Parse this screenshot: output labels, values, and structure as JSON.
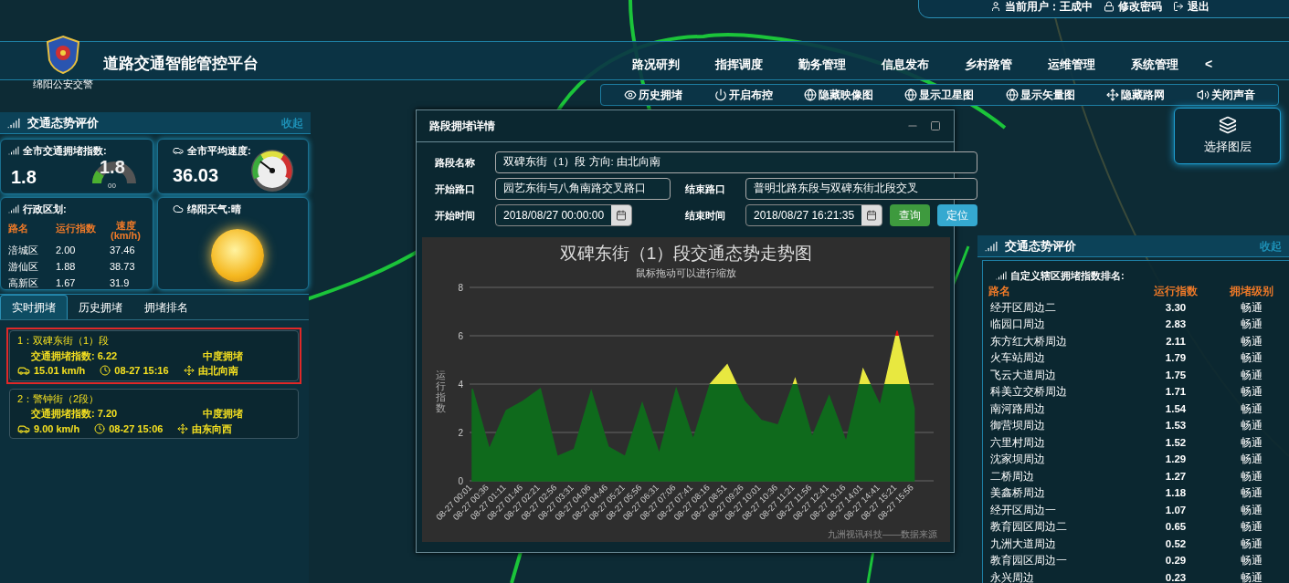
{
  "user_bar": {
    "user": "当前用户：王成中",
    "change_password": "修改密码",
    "logout": "退出"
  },
  "header": {
    "logo_caption": "绵阳公安交警",
    "title": "道路交通智能管控平台",
    "nav": [
      "路况研判",
      "指挥调度",
      "勤务管理",
      "信息发布",
      "乡村路管",
      "运维管理",
      "系统管理"
    ],
    "nav_back": "<"
  },
  "toolbar": [
    {
      "label": "历史拥堵",
      "kind": "eye"
    },
    {
      "label": "开启布控",
      "kind": "power"
    },
    {
      "label": "隐藏映像图",
      "kind": "globe"
    },
    {
      "label": "显示卫星图",
      "kind": "globe"
    },
    {
      "label": "显示矢量图",
      "kind": "globe"
    },
    {
      "label": "隐藏路网",
      "kind": "move"
    },
    {
      "label": "关闭声音",
      "kind": "sound"
    }
  ],
  "layer_button": "选择图层",
  "left_panel": {
    "title": "交通态势评价",
    "collapse": "收起",
    "congestion_index": {
      "label": "全市交通拥堵指数:",
      "value": "1.8",
      "gauge_value": "1.8",
      "gauge_min": "00",
      "level": 0.2
    },
    "avg_speed": {
      "label": "全市平均速度:",
      "value": "36.03"
    },
    "districts": {
      "title": "行政区划:",
      "columns": [
        "路名",
        "运行指数",
        "速度",
        "(km/h)"
      ],
      "rows": [
        {
          "name": "涪城区",
          "index": "2.00",
          "speed": "37.46"
        },
        {
          "name": "游仙区",
          "index": "1.88",
          "speed": "38.73"
        },
        {
          "name": "高新区",
          "index": "1.67",
          "speed": "31.9"
        }
      ]
    },
    "weather": {
      "label": "绵阳天气:晴"
    },
    "tabs": [
      {
        "label": "实时拥堵",
        "selected": true
      },
      {
        "label": "历史拥堵",
        "selected": false
      },
      {
        "label": "拥堵排名",
        "selected": false
      }
    ],
    "jams": [
      {
        "title": "1：双碑东街（1）段",
        "index": "交通拥堵指数: 6.22",
        "grade": "中度拥堵",
        "speed": "15.01 km/h",
        "time": "08-27 15:16",
        "direction": "由北向南",
        "selected": true
      },
      {
        "title": "2：警钟街（2段）",
        "index": "交通拥堵指数: 7.20",
        "grade": "中度拥堵",
        "speed": "9.00 km/h",
        "time": "08-27 15:06",
        "direction": "由东向西",
        "selected": false
      }
    ]
  },
  "dialog": {
    "title": "路段拥堵详情",
    "fields": [
      {
        "label": "路段名称",
        "value": "双碑东街（1）段 方向: 由北向南",
        "kind": "wide"
      },
      {
        "label": "开始路口",
        "value": "园艺东街与八角南路交叉路口",
        "kind": "text"
      },
      {
        "label": "结束路口",
        "value": "普明北路东段与双碑东街北段交叉",
        "kind": "text"
      },
      {
        "label": "开始时间",
        "value": "2018/08/27 00:00:00",
        "kind": "date"
      },
      {
        "label": "结束时间",
        "value": "2018/08/27 16:21:35",
        "kind": "date"
      }
    ],
    "buttons": [
      {
        "label": "查询",
        "kind": "primary"
      },
      {
        "label": "定位",
        "kind": "info"
      }
    ],
    "chart_hint": "鼠标拖动可以进行缩放",
    "chart_credit": "九洲视讯科技——数据来源",
    "chart_data": {
      "type": "area",
      "title": "双碑东街（1）段交通态势走势图",
      "ylabel": "运行指数",
      "categories": [
        "08-27 00:01",
        "08-27 00:36",
        "08-27 01:11",
        "08-27 01:46",
        "08-27 02:21",
        "08-27 02:56",
        "08-27 03:31",
        "08-27 04:06",
        "08-27 04:46",
        "08-27 05:21",
        "08-27 05:56",
        "08-27 06:31",
        "08-27 07:06",
        "08-27 07:41",
        "08-27 08:16",
        "08-27 08:51",
        "08-27 09:26",
        "08-27 10:01",
        "08-27 10:36",
        "08-27 11:21",
        "08-27 11:56",
        "08-27 12:41",
        "08-27 13:16",
        "08-27 14:01",
        "08-27 14:41",
        "08-27 15:21",
        "08-27 15:56"
      ],
      "series": [
        {
          "color": "#0f6a1c",
          "values": [
            3.8,
            1.3,
            2.9,
            3.3,
            3.8,
            1.0,
            1.3,
            3.7,
            1.4,
            1.0,
            3.2,
            1.1,
            3.8,
            1.7,
            4.0,
            4.8,
            3.3,
            2.5,
            2.3,
            4.2,
            1.8,
            3.5,
            1.6,
            4.6,
            3.1,
            6.2,
            3.0
          ]
        }
      ],
      "ylim": [
        0,
        8
      ],
      "yticks": [
        0,
        2,
        4,
        6,
        8
      ],
      "grid": true
    }
  },
  "right_panel": {
    "title": "交通态势评价",
    "collapse": "收起",
    "subtitle": "自定义辖区拥堵指数排名:",
    "columns": [
      "路名",
      "运行指数",
      "拥堵级别"
    ],
    "rows": [
      {
        "name": "经开区周边二",
        "index": "3.30",
        "grade": "畅通"
      },
      {
        "name": "临园口周边",
        "index": "2.83",
        "grade": "畅通"
      },
      {
        "name": "东方红大桥周边",
        "index": "2.11",
        "grade": "畅通"
      },
      {
        "name": "火车站周边",
        "index": "1.79",
        "grade": "畅通"
      },
      {
        "name": "飞云大道周边",
        "index": "1.75",
        "grade": "畅通"
      },
      {
        "name": "科美立交桥周边",
        "index": "1.71",
        "grade": "畅通"
      },
      {
        "name": "南河路周边",
        "index": "1.54",
        "grade": "畅通"
      },
      {
        "name": "御营坝周边",
        "index": "1.53",
        "grade": "畅通"
      },
      {
        "name": "六里村周边",
        "index": "1.52",
        "grade": "畅通"
      },
      {
        "name": "沈家坝周边",
        "index": "1.29",
        "grade": "畅通"
      },
      {
        "name": "二桥周边",
        "index": "1.27",
        "grade": "畅通"
      },
      {
        "name": "美鑫桥周边",
        "index": "1.18",
        "grade": "畅通"
      },
      {
        "name": "经开区周边一",
        "index": "1.07",
        "grade": "畅通"
      },
      {
        "name": "教育园区周边二",
        "index": "0.65",
        "grade": "畅通"
      },
      {
        "name": "九洲大道周边",
        "index": "0.52",
        "grade": "畅通"
      },
      {
        "name": "教育园区周边一",
        "index": "0.29",
        "grade": "畅通"
      },
      {
        "name": "永兴周边",
        "index": "0.23",
        "grade": "畅通"
      }
    ]
  }
}
